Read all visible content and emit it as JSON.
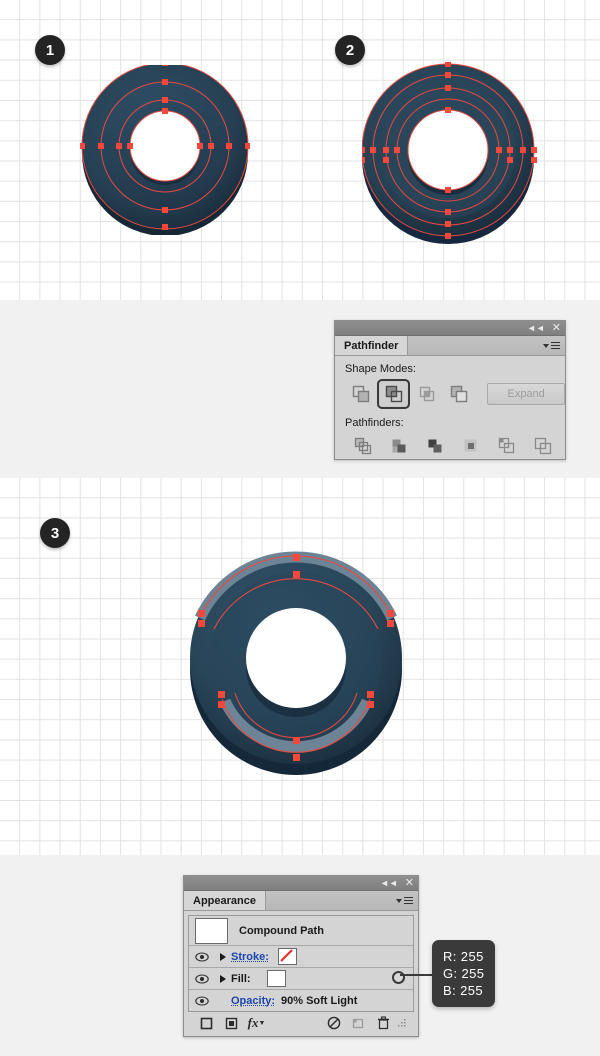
{
  "steps": [
    {
      "num": "1"
    },
    {
      "num": "2"
    },
    {
      "num": "3"
    }
  ],
  "colors": {
    "donut_dark": "#1e3446",
    "donut_mid": "#2c4a5e",
    "donut_edge": "#192c3c",
    "donut_highlight": "#6d8496",
    "anchor_red": "#f4483c",
    "path_red": "#e8493f",
    "badge_bg": "#242424",
    "grid_line": "#e2e2e2",
    "panel_bg": "#d4d4d4",
    "callout_bg": "#3a3a3a"
  },
  "pathfinder_panel": {
    "tab_label": "Pathfinder",
    "collapse_icon": "collapse-icon",
    "close_icon": "close-icon",
    "menu_icon": "panel-menu-icon",
    "shape_modes_label": "Shape Modes:",
    "pathfinders_label": "Pathfinders:",
    "expand_label": "Expand",
    "shape_modes": [
      {
        "name": "unite-icon",
        "selected": false
      },
      {
        "name": "minus-front-icon",
        "selected": true
      },
      {
        "name": "intersect-icon",
        "selected": false
      },
      {
        "name": "exclude-icon",
        "selected": false
      }
    ],
    "pathfinders": [
      {
        "name": "divide-icon"
      },
      {
        "name": "trim-icon"
      },
      {
        "name": "merge-icon"
      },
      {
        "name": "crop-icon"
      },
      {
        "name": "outline-icon"
      },
      {
        "name": "minus-back-icon"
      }
    ]
  },
  "appearance_panel": {
    "tab_label": "Appearance",
    "collapse_icon": "collapse-icon",
    "close_icon": "close-icon",
    "menu_icon": "panel-menu-icon",
    "object_title": "Compound Path",
    "rows": [
      {
        "label": "Stroke:",
        "link": true,
        "swatch": "none-red-slash"
      },
      {
        "label": "Fill:",
        "link": false,
        "swatch": "white"
      }
    ],
    "opacity_label": "Opacity:",
    "opacity_value": "90% Soft Light",
    "footer_icons": [
      "add-new-stroke-icon",
      "add-new-fill-icon",
      "add-new-effect-icon",
      "clear-appearance-icon",
      "duplicate-item-icon",
      "delete-item-icon",
      "resize-grip-icon"
    ]
  },
  "rgb_callout": {
    "r": "R: 255",
    "g": "G: 255",
    "b": "B: 255"
  }
}
